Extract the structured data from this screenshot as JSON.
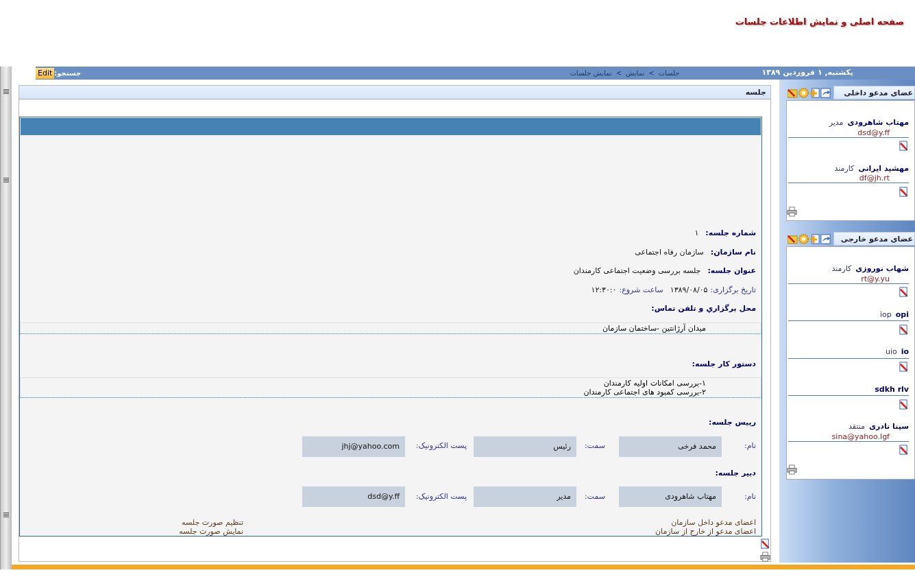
{
  "header": {
    "title": "صفحه اصلی و نمایش اطلاعات جلسات"
  },
  "topbar": {
    "date": "یکشنبه, ۱ فروردین ۱۳۸۹",
    "breadcrumb": [
      "جلسات",
      "نمایش",
      "نمایش جلسات"
    ],
    "breadcrumb_separator": ">",
    "search_label": "جستجو:",
    "edit_button": "Edit"
  },
  "sidebar": [
    {
      "title": "عضای مدعو داخلی",
      "members": [
        {
          "name": "مهتاب شاهرودی",
          "role": "مدیر",
          "email": "dsd@y.ff"
        },
        {
          "name": "مهشید ایرانی",
          "role": "کارمند",
          "email": "df@jh.rt"
        }
      ]
    },
    {
      "title": "عضای مدعو خارجی",
      "members": [
        {
          "name": "شهاب نوروزی",
          "role": "کارمند",
          "email": "rt@y.yu"
        },
        {
          "name": "opi",
          "role": "iop"
        },
        {
          "name": "io",
          "role": "uio"
        },
        {
          "name": "sdkh rlv"
        },
        {
          "name": "سینا نادری",
          "role": "منتقد",
          "email": "sina@yahoo.lgf"
        }
      ]
    }
  ],
  "meeting": {
    "panel_title": "جلسه",
    "facts": [
      {
        "label": "شماره جلسه:",
        "value": "۱"
      },
      {
        "label": "نام سازمان:",
        "value": "سازمان رفاه اجتماعی"
      },
      {
        "label": "عنوان جلسه:",
        "value": "جلسه بررسی وضعیت اجتماعی کارمندان"
      }
    ],
    "date_label": "تاریخ برگزاری:",
    "date": "۱۳۸۹/۰۸/۰۵",
    "time_label": "ساعت شروع:",
    "time": "۱۲:۳۰:۰",
    "location_heading": "محل برگزاري و تلفن تماس:",
    "location": [
      "میدان آرژانتین -ساختمان سازمان"
    ],
    "agenda_heading": "دستور کار جلسه:",
    "agenda": [
      "۱-بررسی امکانات اولیه کارمندان",
      "۲-بررسی کمبود های اجتماعی کارمندان"
    ],
    "people": [
      {
        "heading": "رییس جلسه:",
        "name_label": "نام:",
        "name": "محمد فرخی",
        "role_label": "سمت:",
        "role": "رئیس",
        "email_label": "پست الکترونیک:",
        "email": "jhj@yahoo.com"
      },
      {
        "heading": "دبیر جلسه:",
        "name_label": "نام:",
        "name": "مهتاب شاهرودی",
        "role_label": "سمت:",
        "role": "مدیر",
        "email_label": "پست الکترونیک:",
        "email": "dsd@y.ff"
      }
    ],
    "links_right": [
      "اعضای مدعو داخل سازمان",
      "اعضای مدعو از خارج از سازمان"
    ],
    "links_left": [
      "تنظیم صورت جلسه",
      "نمایش صورت جلسه"
    ]
  }
}
